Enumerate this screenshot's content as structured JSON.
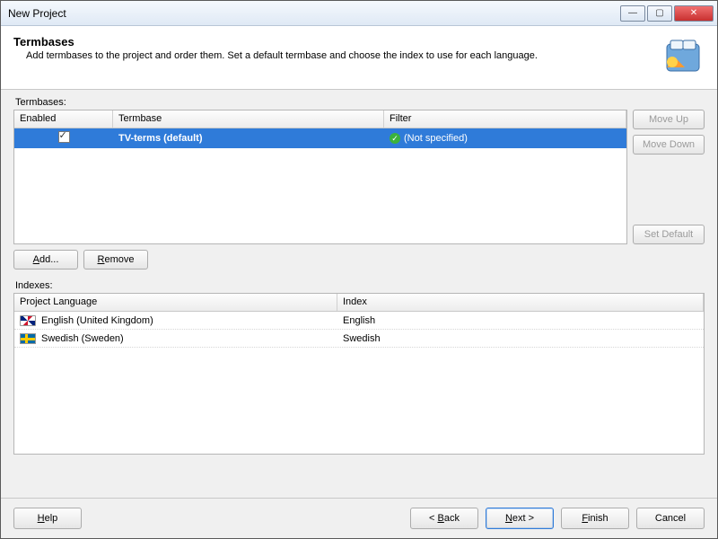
{
  "window": {
    "title": "New Project"
  },
  "header": {
    "title": "Termbases",
    "subtitle": "Add termbases to the project and order them. Set a default termbase and choose the index to use for each language."
  },
  "termbases": {
    "label": "Termbases:",
    "columns": {
      "enabled": "Enabled",
      "termbase": "Termbase",
      "filter": "Filter"
    },
    "rows": [
      {
        "enabled": true,
        "name": "TV-terms (default)",
        "filter": "(Not specified)"
      }
    ],
    "buttons": {
      "moveUp": "Move Up",
      "moveDown": "Move Down",
      "setDefault": "Set Default",
      "add": "Add...",
      "remove": "Remove"
    }
  },
  "indexes": {
    "label": "Indexes:",
    "columns": {
      "projectLanguage": "Project Language",
      "index": "Index"
    },
    "rows": [
      {
        "flag": "uk",
        "language": "English (United Kingdom)",
        "index": "English"
      },
      {
        "flag": "se",
        "language": "Swedish (Sweden)",
        "index": "Swedish"
      }
    ]
  },
  "footer": {
    "help": "Help",
    "back": "< Back",
    "next": "Next >",
    "finish": "Finish",
    "cancel": "Cancel"
  }
}
